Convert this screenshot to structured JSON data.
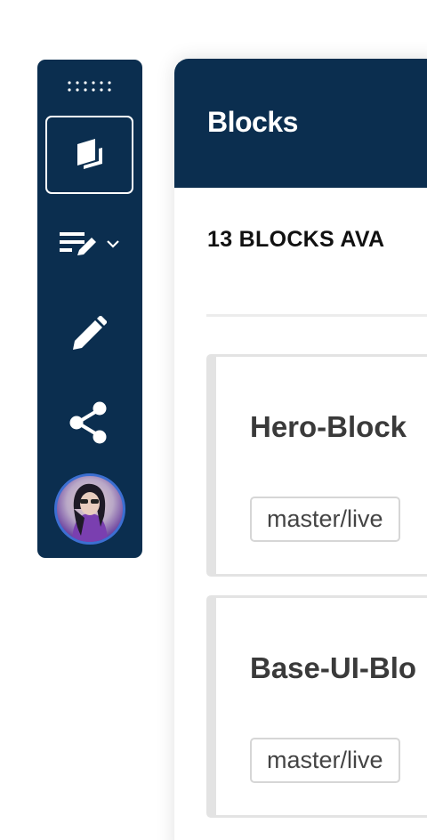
{
  "toolbar": {
    "tools": [
      {
        "icon": "blocks-icon",
        "active": true
      },
      {
        "icon": "text-format-icon",
        "has_dropdown": true
      },
      {
        "icon": "pencil-icon"
      },
      {
        "icon": "share-icon"
      }
    ],
    "accent_color": "#0b2e4f",
    "avatar_ring_color": "#3c6fd2"
  },
  "panel": {
    "title": "Blocks",
    "count_label": "13 BLOCKS AVA",
    "header_color": "#0b2e4f",
    "blocks": [
      {
        "name": "Hero-Block",
        "branch": "master/live"
      },
      {
        "name": "Base-UI-Blo",
        "branch": "master/live"
      }
    ]
  }
}
